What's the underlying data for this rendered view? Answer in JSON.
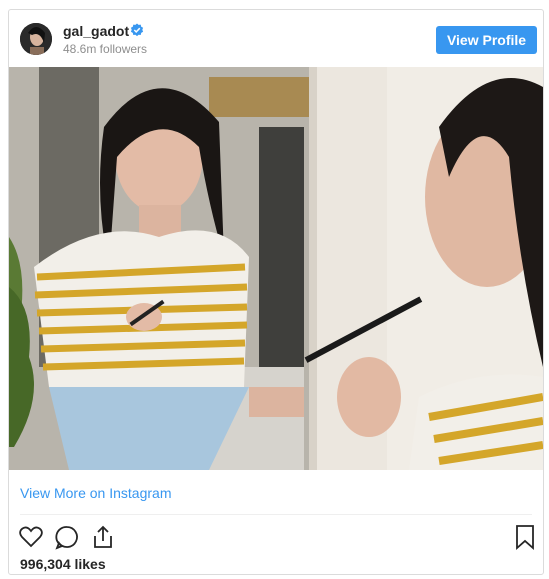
{
  "header": {
    "username": "gal_gadot",
    "followers": "48.6m followers",
    "view_profile_label": "View Profile",
    "verified_icon": "verified-badge-icon"
  },
  "post": {
    "image_alt": "Woman applying eyeliner in front of a mirror",
    "view_more_label": "View More on Instagram",
    "likes": "996,304 likes"
  },
  "actions": {
    "icons": [
      "heart-icon",
      "comment-icon",
      "share-icon",
      "bookmark-icon"
    ]
  },
  "colors": {
    "accent": "#3897f0",
    "text": "#262626",
    "muted": "#8e8e8e",
    "border": "#dbdbdb"
  }
}
